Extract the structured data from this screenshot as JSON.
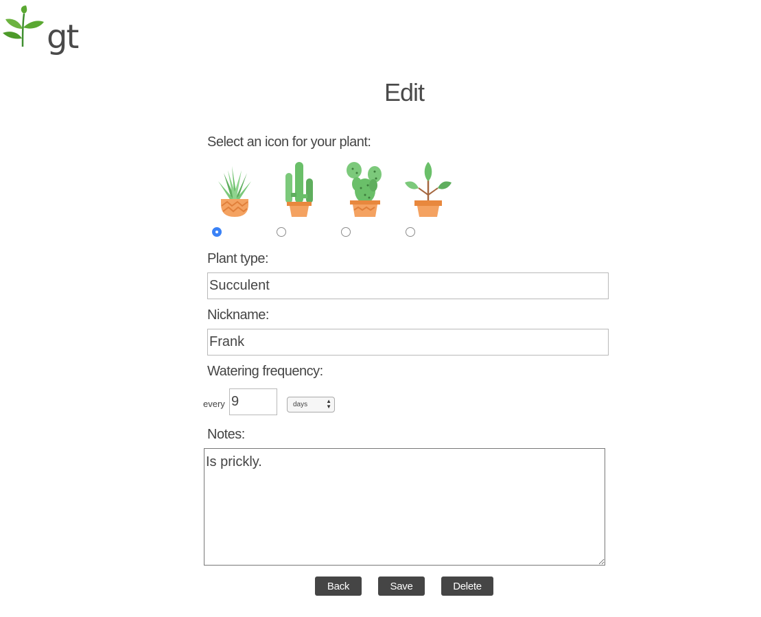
{
  "brand": {
    "logo_text": "gt",
    "logo_icon": "leaf-sprout-icon"
  },
  "page": {
    "title": "Edit"
  },
  "icon_select": {
    "label": "Select an icon for your plant:",
    "options": [
      {
        "icon": "succulent-pot-icon",
        "selected": true
      },
      {
        "icon": "tall-cactus-pot-icon",
        "selected": false
      },
      {
        "icon": "prickly-pear-cactus-pot-icon",
        "selected": false
      },
      {
        "icon": "leafy-sprout-pot-icon",
        "selected": false
      }
    ]
  },
  "plant_type": {
    "label": "Plant type:",
    "value": "Succulent"
  },
  "nickname": {
    "label": "Nickname:",
    "value": "Frank"
  },
  "watering": {
    "label": "Watering frequency:",
    "prefix": "every",
    "value": "9",
    "unit_selected": "days"
  },
  "notes": {
    "label": "Notes:",
    "value": "Is prickly."
  },
  "buttons": {
    "back": "Back",
    "save": "Save",
    "delete": "Delete"
  },
  "colors": {
    "button_bg": "#454545",
    "radio_checked": "#3b82f6",
    "pot": "#f4a261",
    "plant_green": "#6abf69"
  }
}
